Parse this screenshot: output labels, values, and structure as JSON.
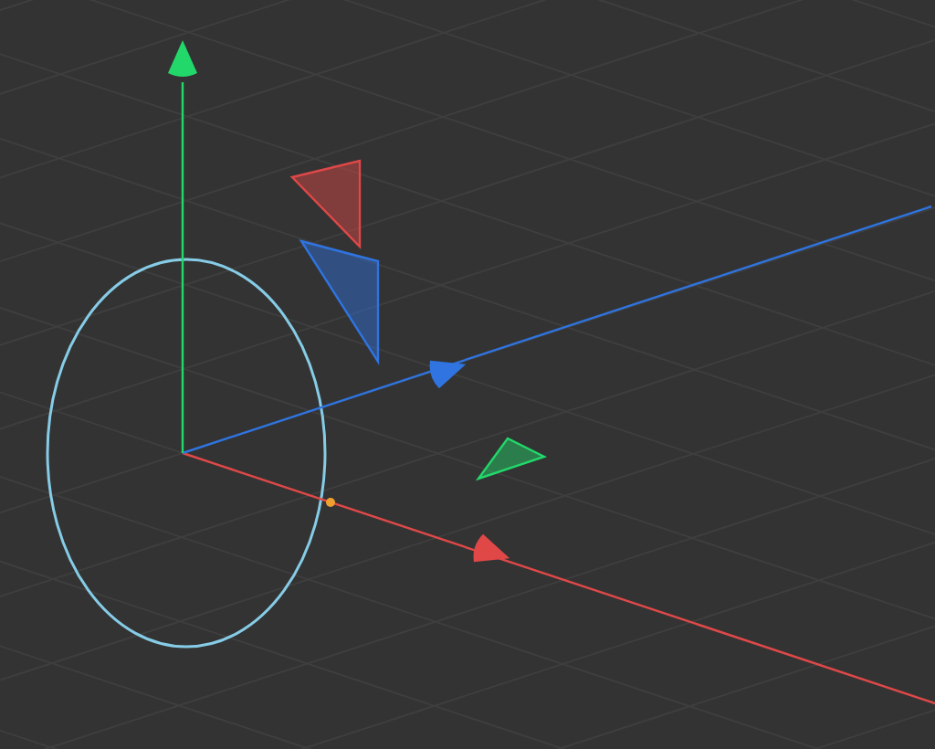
{
  "viewport": {
    "axes": [
      {
        "kind": "x",
        "color": "#e04848"
      },
      {
        "kind": "z",
        "color": "#2f74e0"
      },
      {
        "kind": "y",
        "color": "#22d86a"
      }
    ],
    "rotate_ring": {
      "color": "#86cce6"
    }
  }
}
